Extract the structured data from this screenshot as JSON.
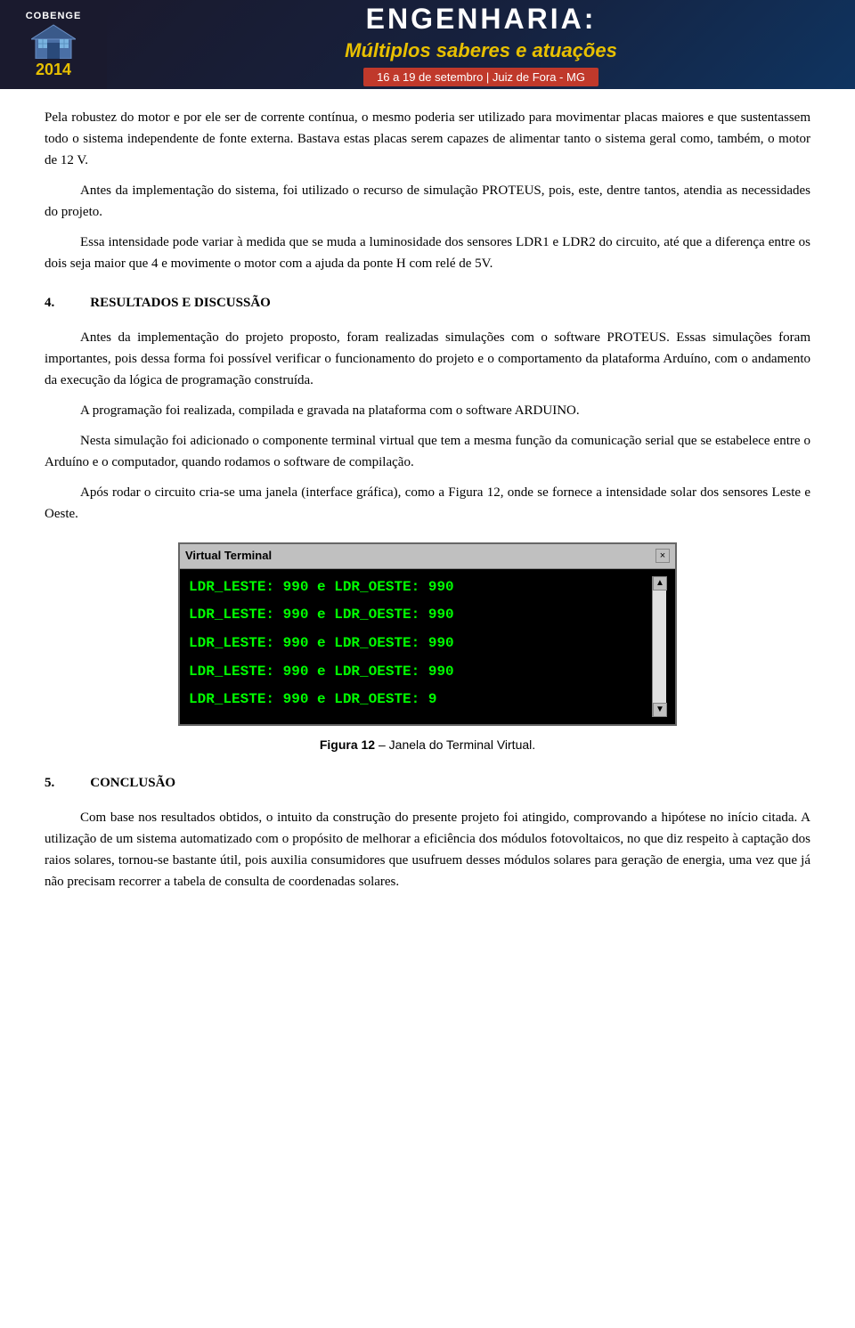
{
  "header": {
    "logo_name": "COBENGE",
    "year": "2014",
    "title_engineering": "ENGENHARIA:",
    "subtitle": "Múltiplos saberes e atuações",
    "date_location": "16 a 19 de setembro  |  Juiz de Fora - MG"
  },
  "paragraphs": {
    "p1": "Pela robustez do motor e por ele ser de corrente contínua, o mesmo poderia ser utilizado para movimentar placas maiores e que sustentassem todo o sistema independente de fonte externa. Bastava estas placas serem capazes de alimentar tanto o sistema geral como, também, o motor de 12 V.",
    "p2": "Antes da implementação do sistema, foi utilizado o recurso de simulação PROTEUS, pois, este, dentre tantos, atendia as necessidades do projeto.",
    "p3": "Essa intensidade pode variar à medida que se muda a luminosidade dos sensores LDR1 e LDR2 do circuito, até que a diferença entre os dois seja maior que 4 e movimente o motor com a ajuda da ponte H com relé de 5V.",
    "section4_number": "4.",
    "section4_title": "RESULTADOS E DISCUSSÃO",
    "p4": "Antes da implementação do projeto proposto, foram realizadas simulações com o software PROTEUS. Essas simulações foram importantes, pois dessa forma foi possível verificar o funcionamento do projeto e o comportamento da plataforma Arduíno, com o andamento da execução da lógica de programação construída.",
    "p5": "A programação foi realizada, compilada e gravada na plataforma com o software ARDUINO.",
    "p6": "Nesta simulação foi adicionado o componente terminal virtual que tem a mesma função da comunicação serial que se estabelece entre o Arduíno e o computador, quando rodamos o software de compilação.",
    "p7": "Após rodar o circuito cria-se uma janela (interface gráfica), como a Figura 12, onde se fornece a intensidade solar dos sensores Leste e Oeste.",
    "section5_number": "5.",
    "section5_title": "CONCLUSÃO",
    "p8": "Com base nos resultados obtidos, o intuito da construção do presente projeto foi atingido, comprovando a hipótese no início citada. A utilização de um sistema automatizado com o propósito de melhorar a eficiência dos módulos fotovoltaicos, no que diz respeito à captação dos raios solares, tornou-se bastante útil, pois auxilia consumidores que usufruem desses módulos solares para geração de energia, uma vez que já não precisam recorrer a tabela de consulta de coordenadas solares."
  },
  "terminal": {
    "title": "Virtual Terminal",
    "close_btn": "×",
    "lines": [
      "LDR_LESTE: 990 e LDR_OESTE: 990",
      "LDR_LESTE: 990 e LDR_OESTE: 990",
      "LDR_LESTE: 990 e LDR_OESTE: 990",
      "LDR_LESTE: 990 e LDR_OESTE: 990",
      "LDR_LESTE: 990 e LDR_OESTE:   9"
    ],
    "scrollbar_up": "▲",
    "scrollbar_down": "▼"
  },
  "figure_caption": {
    "label": "Figura 12",
    "separator": " – ",
    "description": "Janela do Terminal Virtual."
  }
}
